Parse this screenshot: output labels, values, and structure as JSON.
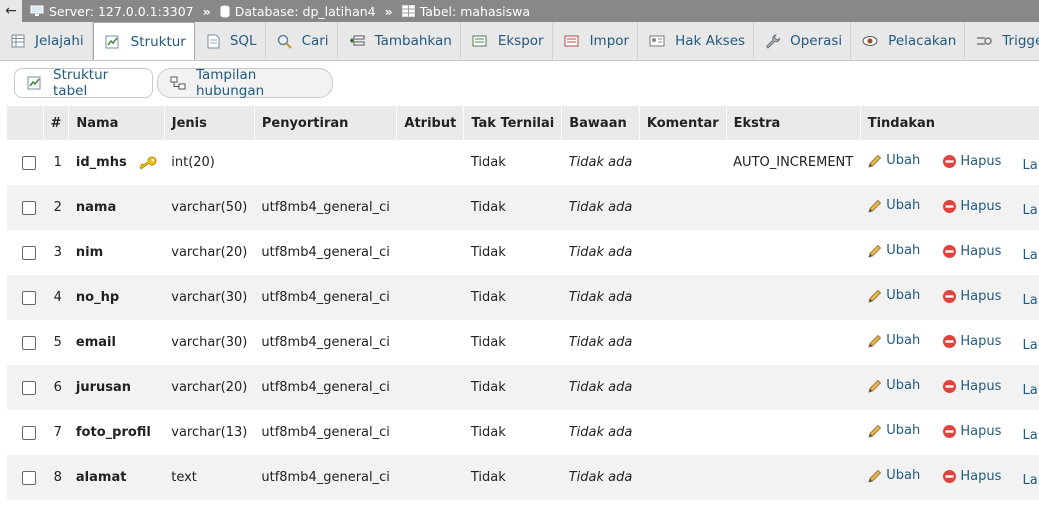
{
  "breadcrumb": {
    "back_glyph": "←",
    "server_label": "Server: 127.0.0.1:3307",
    "separator": "»",
    "database_label": "Database: dp_latihan4",
    "table_label": "Tabel: mahasiswa"
  },
  "tabs": [
    {
      "label": "Jelajahi",
      "icon": "browse-icon"
    },
    {
      "label": "Struktur",
      "icon": "structure-icon",
      "active": true
    },
    {
      "label": "SQL",
      "icon": "sql-icon"
    },
    {
      "label": "Cari",
      "icon": "search-icon"
    },
    {
      "label": "Tambahkan",
      "icon": "insert-icon"
    },
    {
      "label": "Ekspor",
      "icon": "export-icon"
    },
    {
      "label": "Impor",
      "icon": "import-icon"
    },
    {
      "label": "Hak Akses",
      "icon": "privileges-icon"
    },
    {
      "label": "Operasi",
      "icon": "wrench-icon"
    },
    {
      "label": "Pelacakan",
      "icon": "eye-icon"
    },
    {
      "label": "Trigger",
      "icon": "trigger-icon"
    }
  ],
  "subnav": {
    "structure_label": "Struktur tabel",
    "relation_label": "Tampilan hubungan"
  },
  "table": {
    "headers": {
      "num": "#",
      "name": "Nama",
      "type": "Jenis",
      "collation": "Penyortiran",
      "attributes": "Atribut",
      "null": "Tak Ternilai",
      "default": "Bawaan",
      "comment": "Komentar",
      "extra": "Ekstra",
      "action": "Tindakan"
    },
    "action_labels": {
      "edit": "Ubah",
      "drop": "Hapus",
      "more": "Lainnya"
    },
    "rows": [
      {
        "num": "1",
        "name": "id_mhs",
        "type": "int(20)",
        "collation": "",
        "null": "Tidak",
        "default": "Tidak ada",
        "extra": "AUTO_INCREMENT",
        "primary": true
      },
      {
        "num": "2",
        "name": "nama",
        "type": "varchar(50)",
        "collation": "utf8mb4_general_ci",
        "null": "Tidak",
        "default": "Tidak ada",
        "extra": ""
      },
      {
        "num": "3",
        "name": "nim",
        "type": "varchar(20)",
        "collation": "utf8mb4_general_ci",
        "null": "Tidak",
        "default": "Tidak ada",
        "extra": ""
      },
      {
        "num": "4",
        "name": "no_hp",
        "type": "varchar(30)",
        "collation": "utf8mb4_general_ci",
        "null": "Tidak",
        "default": "Tidak ada",
        "extra": ""
      },
      {
        "num": "5",
        "name": "email",
        "type": "varchar(30)",
        "collation": "utf8mb4_general_ci",
        "null": "Tidak",
        "default": "Tidak ada",
        "extra": ""
      },
      {
        "num": "6",
        "name": "jurusan",
        "type": "varchar(20)",
        "collation": "utf8mb4_general_ci",
        "null": "Tidak",
        "default": "Tidak ada",
        "extra": ""
      },
      {
        "num": "7",
        "name": "foto_profil",
        "type": "varchar(13)",
        "collation": "utf8mb4_general_ci",
        "null": "Tidak",
        "default": "Tidak ada",
        "extra": ""
      },
      {
        "num": "8",
        "name": "alamat",
        "type": "text",
        "collation": "utf8mb4_general_ci",
        "null": "Tidak",
        "default": "Tidak ada",
        "extra": ""
      }
    ]
  },
  "colors": {
    "link": "#235a81",
    "drop": "#e0433b",
    "key": "#d8a600",
    "pencil": "#d9a53a"
  }
}
